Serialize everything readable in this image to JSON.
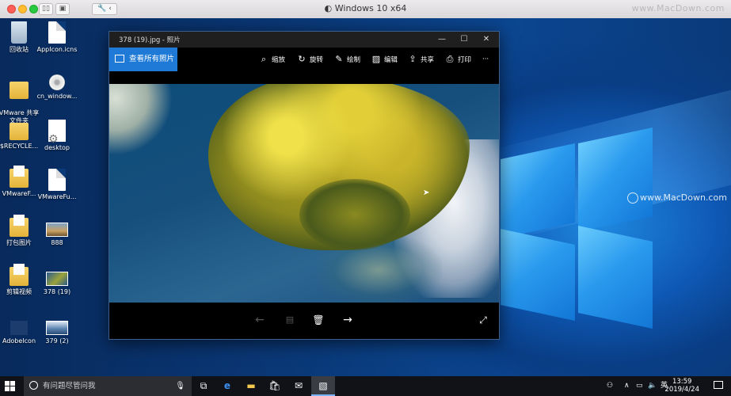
{
  "host": {
    "window_title": "Windows 10 x64",
    "watermark_top": "www.MacDown.com",
    "watermark_mid": "www.MacDown.com"
  },
  "desktop_icons": [
    {
      "label": "回收站",
      "icon": "recycle-bin-icon"
    },
    {
      "label": "AppIcon.icns",
      "icon": "document-icon"
    },
    {
      "label": "VMware 共享\n文件夹",
      "icon": "shared-folder-icon"
    },
    {
      "label": "cn_window...",
      "icon": "disc-image-icon"
    },
    {
      "label": "$RECYCLE...",
      "icon": "folder-icon"
    },
    {
      "label": "desktop",
      "icon": "settings-file-icon"
    },
    {
      "label": "VMwareF...",
      "icon": "folder-document-icon"
    },
    {
      "label": "VMwareFu...",
      "icon": "document-icon"
    },
    {
      "label": "打包图片",
      "icon": "folder-document-icon"
    },
    {
      "label": "888",
      "icon": "image-thumbnail-icon"
    },
    {
      "label": "剪辑视频",
      "icon": "folder-document-icon"
    },
    {
      "label": "378 (19)",
      "icon": "image-thumbnail-icon"
    },
    {
      "label": "AdobeIcon",
      "icon": "image-thumbnail-icon"
    },
    {
      "label": "379 (2)",
      "icon": "image-thumbnail-icon"
    }
  ],
  "photos_window": {
    "title": "378 (19).jpg - 照片",
    "all_photos": "查看所有照片",
    "tools": {
      "zoom": "缩放",
      "rotate": "旋转",
      "draw": "绘制",
      "edit": "编辑",
      "share": "共享",
      "print": "打印"
    }
  },
  "taskbar": {
    "search_placeholder": "有问题尽管问我",
    "ime": "英",
    "time": "13:59",
    "date": "2019/4/24"
  }
}
